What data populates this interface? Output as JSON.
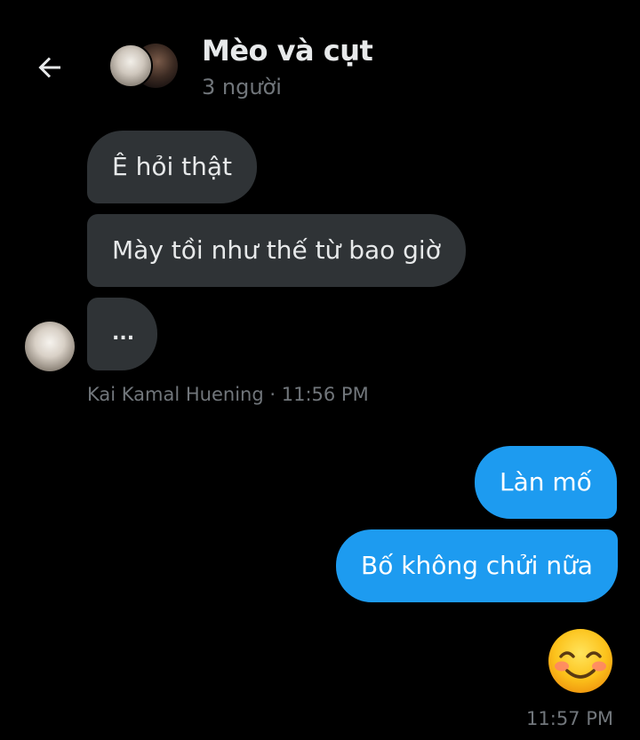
{
  "header": {
    "back_icon": "arrow-left-icon",
    "title": "Mèo và cụt",
    "subtitle": "3 người"
  },
  "messages": [
    {
      "direction": "in",
      "text": "Ê hỏi thật"
    },
    {
      "direction": "in",
      "text": "Mày tồi như thế từ bao giờ"
    },
    {
      "direction": "in",
      "text": "..."
    },
    {
      "direction": "out",
      "text": "Làn mố"
    },
    {
      "direction": "out",
      "text": "Bố không chửi nữa"
    }
  ],
  "incoming_meta": "Kai Kamal Huening · 11:56 PM",
  "outgoing_emoji": "smiling-face-with-blush-icon",
  "outgoing_time": "11:57 PM",
  "colors": {
    "background": "#000000",
    "incoming_bubble": "#2f3336",
    "outgoing_bubble": "#1d9bf0",
    "muted_text": "#71767b"
  }
}
